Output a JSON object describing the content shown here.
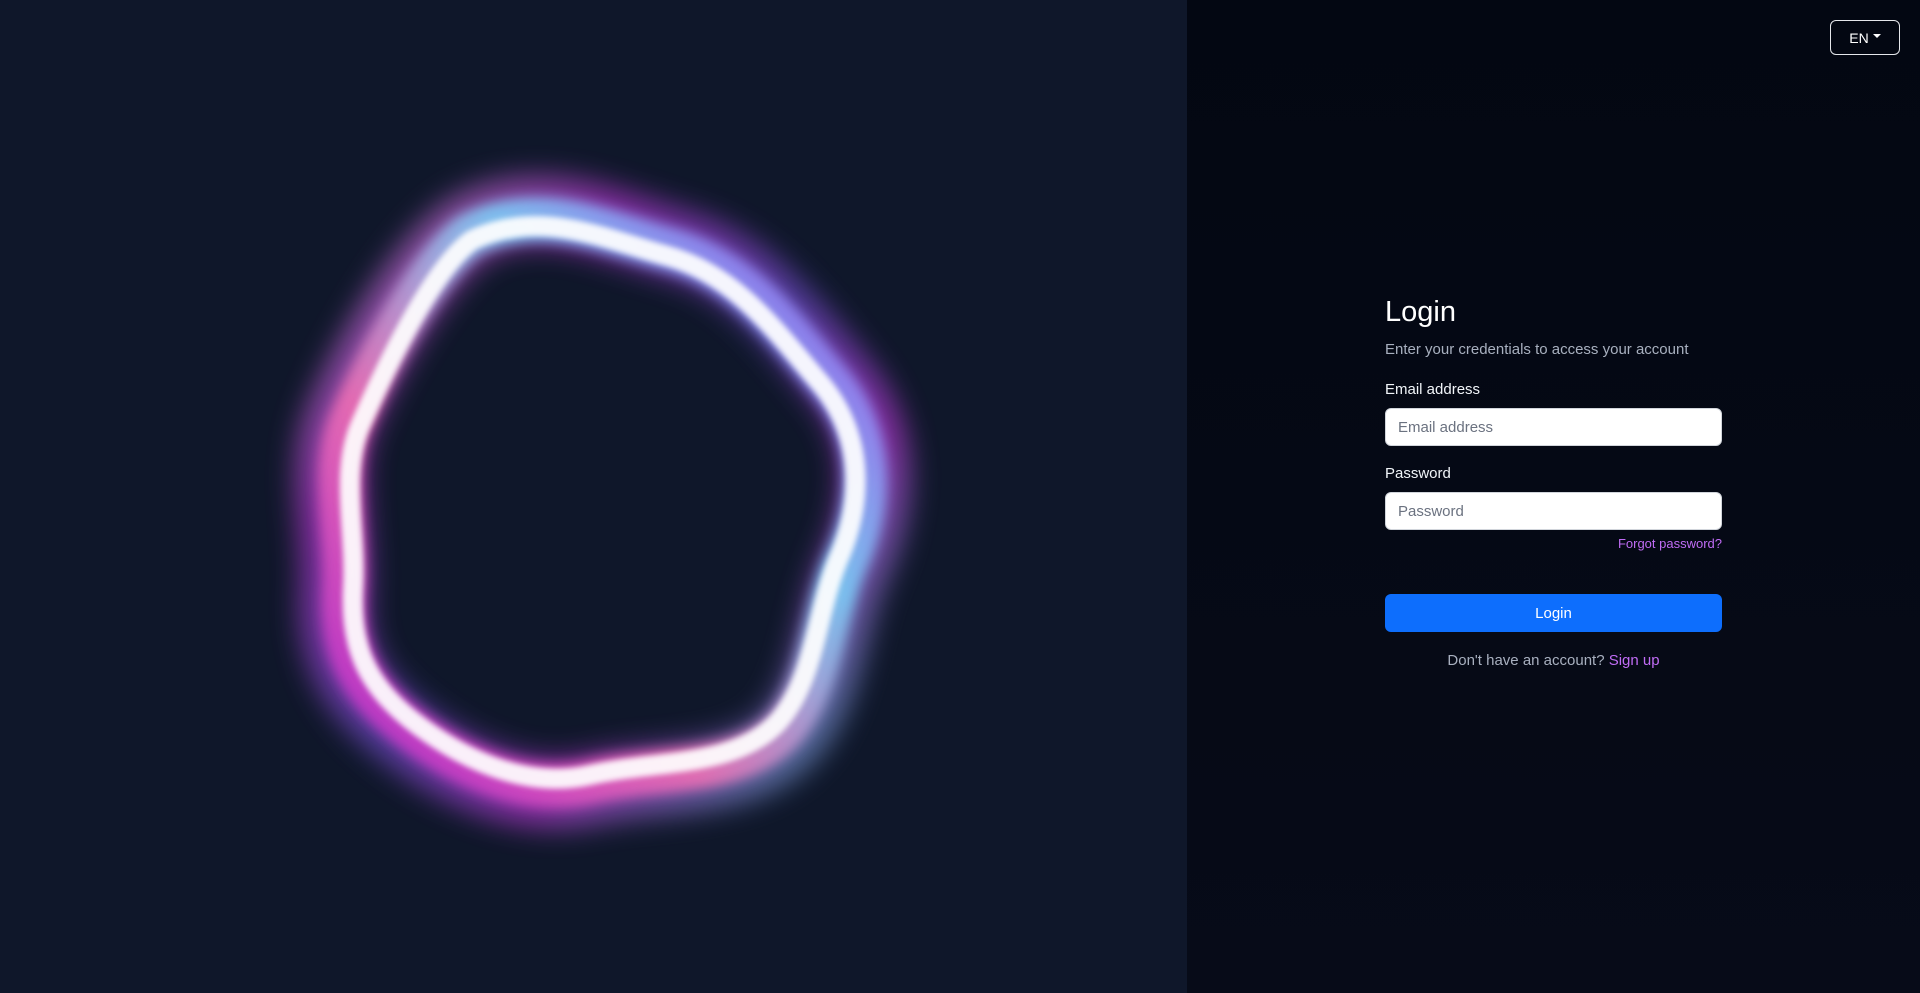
{
  "language": {
    "selected": "EN"
  },
  "login": {
    "title": "Login",
    "subtitle": "Enter your credentials to access your account",
    "email_label": "Email address",
    "email_placeholder": "Email address",
    "email_value": "",
    "password_label": "Password",
    "password_placeholder": "Password",
    "password_value": "",
    "forgot_link": "Forgot password?",
    "submit_label": "Login",
    "no_account_text": "Don't have an account?",
    "signup_link": "Sign up"
  },
  "colors": {
    "left_bg": "#0f172a",
    "right_bg": "#030712",
    "primary": "#0d6efd",
    "link_accent": "#c06cf5",
    "orb_magenta": "#e040fb",
    "orb_cyan": "#7dd3fc",
    "orb_violet": "#7c3aed"
  },
  "hero": {
    "graphic": "glowing-ring-orb"
  }
}
